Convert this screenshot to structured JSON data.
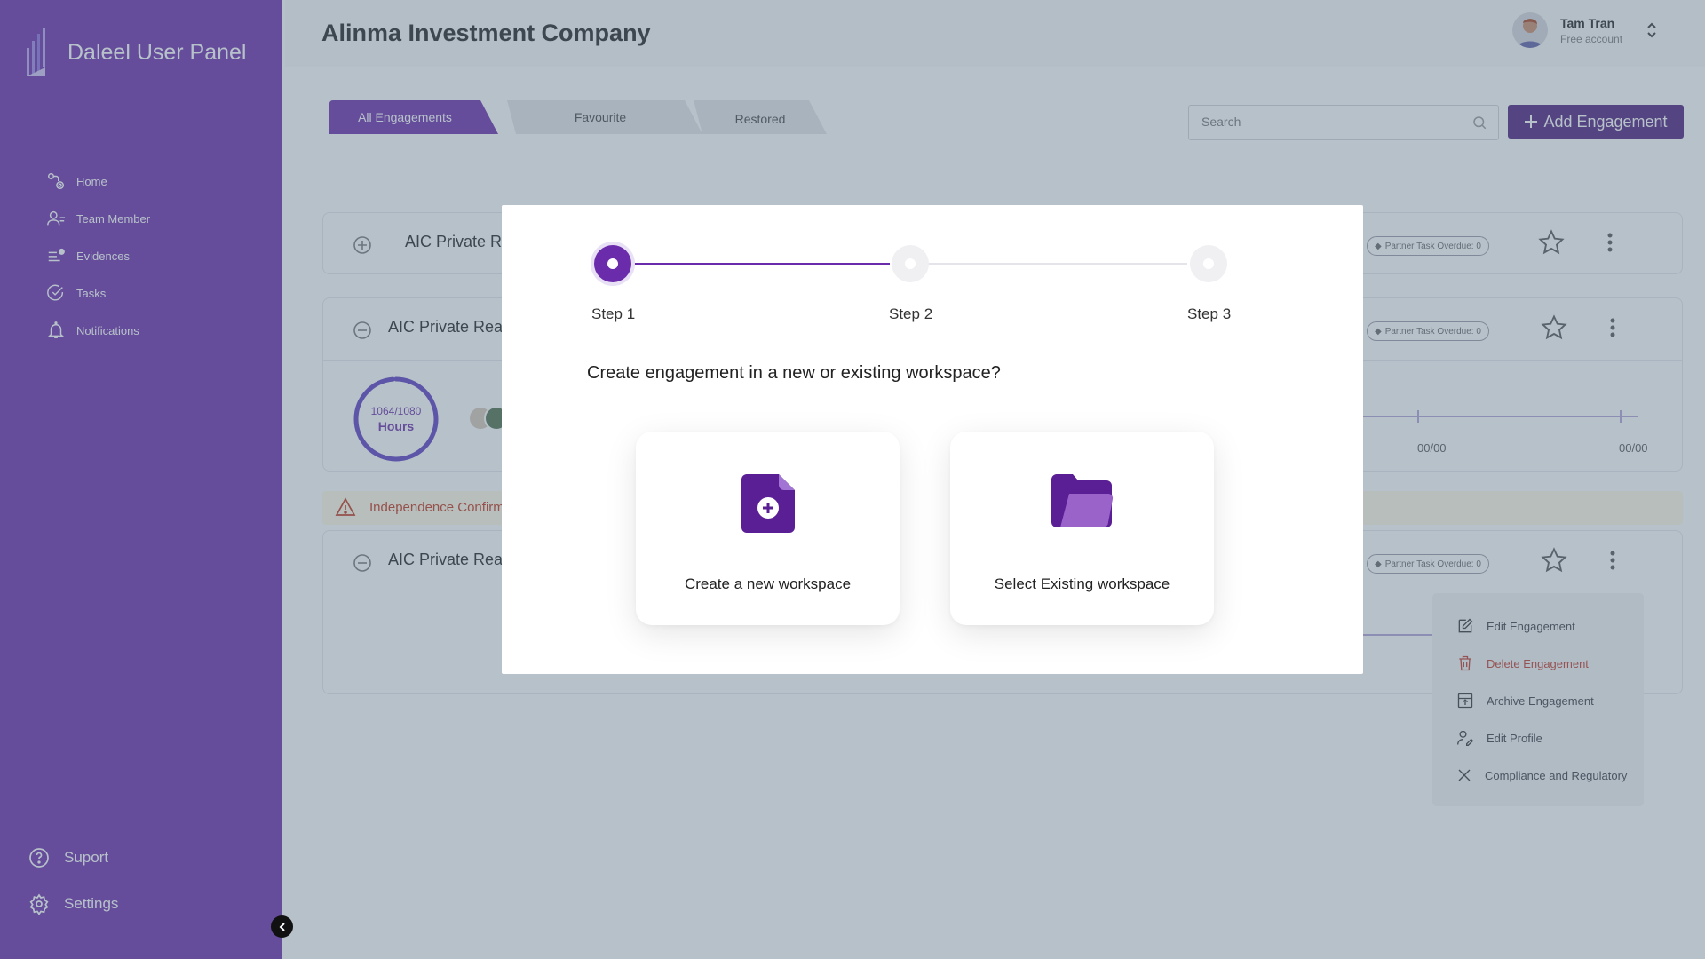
{
  "sidebar": {
    "brand_title": "Daleel User Panel",
    "nav": [
      {
        "label": "Home",
        "icon": "home-icon"
      },
      {
        "label": "Team Member",
        "icon": "team-icon"
      },
      {
        "label": "Evidences",
        "icon": "evidences-icon"
      },
      {
        "label": "Tasks",
        "icon": "tasks-icon"
      },
      {
        "label": "Notifications",
        "icon": "bell-icon"
      }
    ],
    "bottom": [
      {
        "label": "Suport",
        "icon": "help-icon"
      },
      {
        "label": "Settings",
        "icon": "gear-icon"
      }
    ]
  },
  "header": {
    "title": "Alinma Investment Company",
    "user_name": "Tam Tran",
    "user_plan": "Free account"
  },
  "tabs": [
    {
      "label": "All Engagements",
      "active": true
    },
    {
      "label": "Favourite",
      "active": false
    },
    {
      "label": "Restored",
      "active": false
    }
  ],
  "search": {
    "placeholder": "Search",
    "value": ""
  },
  "add_button": {
    "label": "Add Engagement"
  },
  "engagements": [
    {
      "name": "AIC Private Re",
      "partner_task": "Partner Task Overdue: 0"
    },
    {
      "name": "AIC Private Real",
      "partner_task": "Partner Task Overdue: 0",
      "hours": "1064/1080",
      "hours_unit": "Hours",
      "hours_progress": 0.985,
      "dates": [
        "00/00",
        "00/00"
      ]
    },
    {
      "name": "AIC Private Real",
      "partner_task": "Partner Task Overdue: 0"
    }
  ],
  "alert": {
    "text": "Independence Confirm"
  },
  "row_menu": [
    {
      "label": "Edit Engagement",
      "icon": "edit-icon"
    },
    {
      "label": "Delete Engagement",
      "icon": "trash-icon",
      "danger": true
    },
    {
      "label": "Archive Engagement",
      "icon": "archive-icon"
    },
    {
      "label": "Edit Profile",
      "icon": "edit-profile-icon"
    },
    {
      "label": "Compliance and Regulatory",
      "icon": "close-icon"
    }
  ],
  "modal": {
    "steps": [
      "Step 1",
      "Step 2",
      "Step 3"
    ],
    "current_step": 1,
    "question": "Create engagement in a new or existing workspace?",
    "options": [
      {
        "label": "Create a new workspace",
        "icon": "new-file-icon"
      },
      {
        "label": "Select Existing workspace",
        "icon": "folder-icon"
      }
    ]
  },
  "colors": {
    "brand": "#6a2cab",
    "brand_dark": "#4b1d7d",
    "danger": "#c0392b",
    "overlay": "rgba(96,118,135,0.45)"
  }
}
